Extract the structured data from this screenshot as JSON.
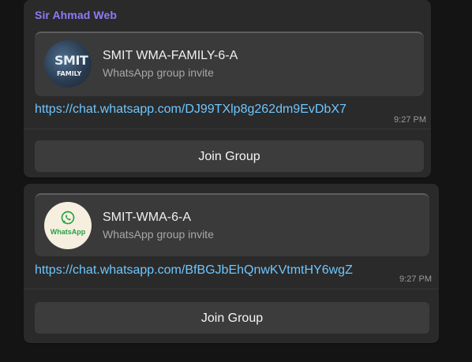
{
  "messages": [
    {
      "sender": "Sir  Ahmad Web",
      "invite": {
        "thumbnail_line1": "SMIT",
        "thumbnail_line2": "FAMILY",
        "group_name": "SMIT WMA-FAMILY-6-A",
        "subtitle": "WhatsApp group invite"
      },
      "link": "https://chat.whatsapp.com/DJ99TXlp8g262dm9EvDbX7",
      "time": "9:27 PM",
      "button_label": "Join Group"
    },
    {
      "invite": {
        "thumbnail_icon": "whatsapp-logo-icon",
        "thumbnail_text": "WhatsApp",
        "group_name": "SMIT-WMA-6-A",
        "subtitle": "WhatsApp group invite"
      },
      "link": "https://chat.whatsapp.com/BfBGJbEhQnwKVtmtHY6wgZ",
      "time": "9:27 PM",
      "button_label": "Join Group"
    }
  ],
  "colors": {
    "sender": "#8b7cf6",
    "link": "#6ec6ff",
    "bubble": "#2a2a2a",
    "preview": "#3a3a3a",
    "button": "#3c3c3c",
    "whatsapp_green": "#25a244"
  }
}
